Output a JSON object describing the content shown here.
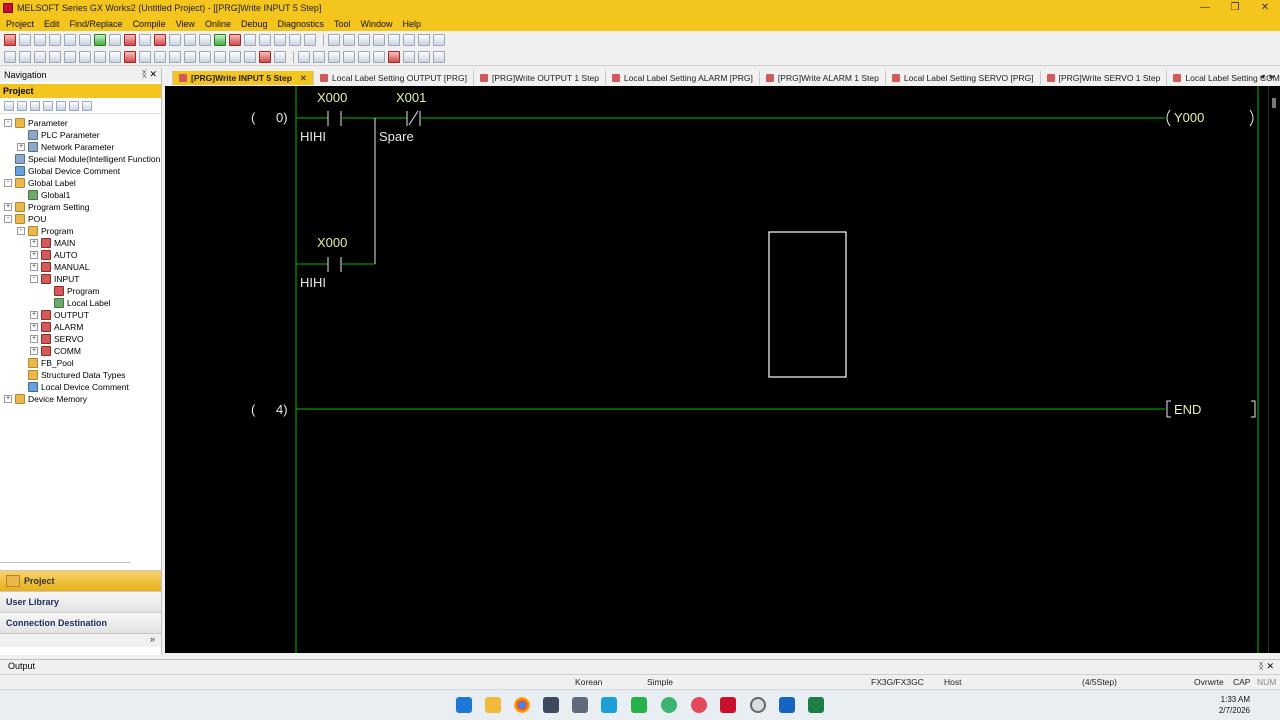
{
  "window": {
    "title": "MELSOFT Series GX Works2 (Untitled Project) - [[PRG]Write INPUT 5 Step]",
    "controls": [
      "—",
      "❐",
      "✕"
    ]
  },
  "menu": [
    "Project",
    "Edit",
    "Find/Replace",
    "Compile",
    "View",
    "Online",
    "Debug",
    "Diagnostics",
    "Tool",
    "Window",
    "Help"
  ],
  "navigation": {
    "title": "Navigation",
    "pin": "ᛝ",
    "close": "✕",
    "section": "Project",
    "tree": [
      {
        "label": "Parameter",
        "expand": "-",
        "icon": "folder",
        "indent": 0
      },
      {
        "label": "PLC Parameter",
        "expand": "",
        "icon": "param",
        "indent": 1
      },
      {
        "label": "Network Parameter",
        "expand": "+",
        "icon": "param",
        "indent": 1
      },
      {
        "label": "Special Module(Intelligent Function M",
        "expand": "",
        "icon": "param",
        "indent": 0
      },
      {
        "label": "Global Device Comment",
        "expand": "",
        "icon": "dev",
        "indent": 0
      },
      {
        "label": "Global Label",
        "expand": "-",
        "icon": "folder",
        "indent": 0
      },
      {
        "label": "Global1",
        "expand": "",
        "icon": "label",
        "indent": 1
      },
      {
        "label": "Program Setting",
        "expand": "+",
        "icon": "folder",
        "indent": 0
      },
      {
        "label": "POU",
        "expand": "-",
        "icon": "folder",
        "indent": 0
      },
      {
        "label": "Program",
        "expand": "-",
        "icon": "folder",
        "indent": 1
      },
      {
        "label": "MAIN",
        "expand": "+",
        "icon": "prog",
        "indent": 2
      },
      {
        "label": "AUTO",
        "expand": "+",
        "icon": "prog",
        "indent": 2
      },
      {
        "label": "MANUAL",
        "expand": "+",
        "icon": "prog",
        "indent": 2
      },
      {
        "label": "INPUT",
        "expand": "-",
        "icon": "prog",
        "indent": 2
      },
      {
        "label": "Program",
        "expand": "",
        "icon": "prog",
        "indent": 3
      },
      {
        "label": "Local Label",
        "expand": "",
        "icon": "label",
        "indent": 3
      },
      {
        "label": "OUTPUT",
        "expand": "+",
        "icon": "prog",
        "indent": 2
      },
      {
        "label": "ALARM",
        "expand": "+",
        "icon": "prog",
        "indent": 2
      },
      {
        "label": "SERVO",
        "expand": "+",
        "icon": "prog",
        "indent": 2
      },
      {
        "label": "COMM",
        "expand": "+",
        "icon": "prog",
        "indent": 2
      },
      {
        "label": "FB_Pool",
        "expand": "",
        "icon": "folder",
        "indent": 1
      },
      {
        "label": "Structured Data Types",
        "expand": "",
        "icon": "folder",
        "indent": 1
      },
      {
        "label": "Local Device Comment",
        "expand": "",
        "icon": "dev",
        "indent": 1
      },
      {
        "label": "Device Memory",
        "expand": "+",
        "icon": "folder",
        "indent": 0
      }
    ],
    "buttons": [
      "Project",
      "User Library",
      "Connection Destination"
    ],
    "more": "»"
  },
  "tabs": [
    {
      "label": "[PRG]Write INPUT 5 Step",
      "active": true,
      "close": "✕"
    },
    {
      "label": "Local Label Setting OUTPUT [PRG]",
      "active": false
    },
    {
      "label": "[PRG]Write OUTPUT 1 Step",
      "active": false
    },
    {
      "label": "Local Label Setting ALARM [PRG]",
      "active": false
    },
    {
      "label": "[PRG]Write ALARM 1 Step",
      "active": false
    },
    {
      "label": "Local Label Setting SERVO [PRG]",
      "active": false
    },
    {
      "label": "[PRG]Write SERVO 1 Step",
      "active": false
    },
    {
      "label": "Local Label Setting COMM [PRG]",
      "active": false
    }
  ],
  "tab_nav": "◄ ►",
  "ladder": {
    "rung1": {
      "step": "0)",
      "open_paren": "(",
      "contact1_device": "X000",
      "contact1_comment": "HIHI",
      "contact2_device": "X001",
      "contact2_comment": "Spare",
      "branch_device": "X000",
      "branch_comment": "HIHI",
      "coil_device": "Y000"
    },
    "rung2": {
      "step": "4)",
      "open_paren": "(",
      "instruction": "END"
    },
    "colors": {
      "rail": "#00c000",
      "text": "#e8e8e8",
      "device": "#e6f0a0",
      "cursor": "#ffffff"
    }
  },
  "output": {
    "label": "Output",
    "controls": "ᛝ ✕"
  },
  "status": {
    "language": "Korean",
    "mode": "Simple",
    "plc": "FX3G/FX3GC",
    "connection": "Host",
    "steps": "(4/5Step)",
    "ovr": "Ovrwrte",
    "cap": "CAP",
    "num": "NUM"
  },
  "clock": {
    "time": "1:33 AM",
    "date": "2/7/2026"
  },
  "taskbar_icons": [
    "windows-start-icon",
    "file-explorer-icon",
    "chrome-icon",
    "notepad-icon",
    "calculator-icon",
    "edge-icon",
    "wechat-icon",
    "app-icon",
    "chat-icon",
    "melsoft-icon",
    "tool-icon",
    "outlook-icon",
    "excel-icon"
  ]
}
